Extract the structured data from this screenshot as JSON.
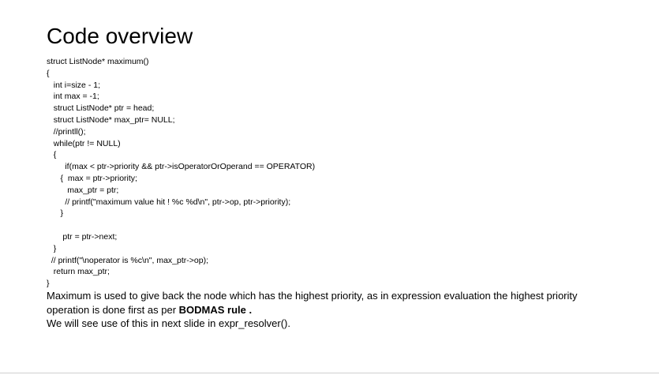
{
  "slide": {
    "title": "Code overview",
    "code_lines": [
      "struct ListNode* maximum()",
      "{",
      "   int i=size - 1;",
      "   int max = -1;",
      "   struct ListNode* ptr = head;",
      "   struct ListNode* max_ptr= NULL;",
      "   //printll();",
      "   while(ptr != NULL)",
      "   {",
      "        if(max < ptr->priority && ptr->isOperatorOrOperand == OPERATOR)",
      "      {  max = ptr->priority;",
      "         max_ptr = ptr;",
      "        // printf(\"maximum value hit ! %c %d\\n\", ptr->op, ptr->priority);",
      "      }",
      "",
      "       ptr = ptr->next;",
      "   }",
      "  // printf(\"\\noperator is %c\\n\", max_ptr->op);",
      "   return max_ptr;",
      "}"
    ],
    "explanation": {
      "line1": "Maximum is used to give back the node which has the highest priority, as in expression evaluation the highest priority",
      "line2_prefix": "operation is done first as per ",
      "line2_bold": "BODMAS rule .",
      "line3": "We will see use of this in next slide in expr_resolver()."
    }
  }
}
